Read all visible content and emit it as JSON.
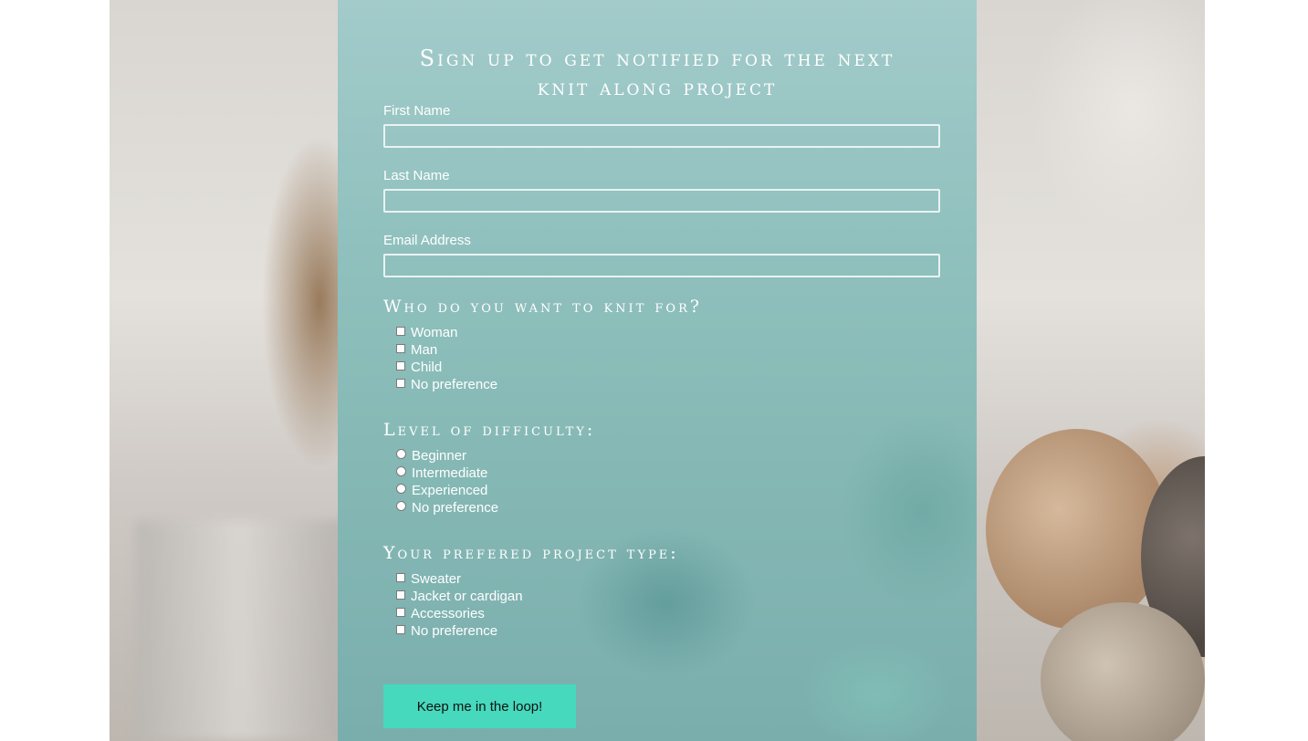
{
  "form": {
    "title": "Sign up to get notified for the next knit along project",
    "first_name_label": "First Name",
    "last_name_label": "Last Name",
    "email_label": "Email Address",
    "first_name_value": "",
    "last_name_value": "",
    "email_value": "",
    "knit_for": {
      "title": "Who do you want to knit for?",
      "options": [
        "Woman",
        "Man",
        "Child",
        "No preference"
      ]
    },
    "difficulty": {
      "title": "Level of difficulty:",
      "options": [
        "Beginner",
        "Intermediate",
        "Experienced",
        "No preference"
      ]
    },
    "project_type": {
      "title": "Your prefered project type:",
      "options": [
        "Sweater",
        "Jacket or cardigan",
        "Accessories",
        "No preference"
      ]
    },
    "submit_label": "Keep me in the loop!"
  },
  "colors": {
    "panel": "#8fc0bd",
    "button": "#46d9bd",
    "text": "#ffffff"
  }
}
